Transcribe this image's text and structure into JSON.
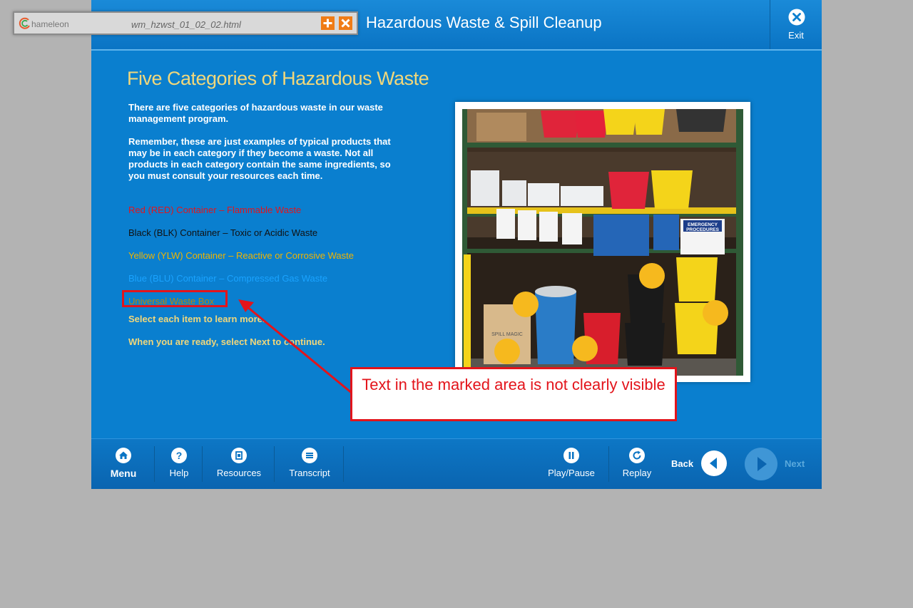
{
  "header": {
    "course_title": "Hazardous Waste & Spill Cleanup",
    "exit_label": "Exit"
  },
  "page": {
    "title": "Five Categories of Hazardous Waste",
    "intro_1": "There are five categories of hazardous waste in our waste management program.",
    "intro_2": "Remember, these are just examples of typical products that may be in each category if they become a waste.  Not all products in each category contain the same ingredients, so you must consult your resources each time.",
    "categories": [
      {
        "label": "Red (RED) Container – Flammable Waste",
        "color": "#e3141b"
      },
      {
        "label": "Black (BLK) Container – Toxic or Acidic Waste",
        "color": "#111111"
      },
      {
        "label": "Yellow (YLW) Container – Reactive or Corrosive Waste",
        "color": "#f0b400"
      },
      {
        "label": "Blue (BLU) Container – Compressed Gas Waste",
        "color": "#1aa3ff"
      },
      {
        "label": "Universal Waste Box",
        "color": "#b8860b"
      }
    ],
    "instruction_1": "Select each item to learn more.",
    "instruction_2": "When you are ready, select Next to continue.",
    "photo_signs": {
      "spill_box": "SPILL MAGIC",
      "emergency_line1": "EMERGENCY",
      "emergency_line2": "PROCEDURES"
    }
  },
  "footer": {
    "menu": "Menu",
    "help": "Help",
    "resources": "Resources",
    "transcript": "Transcript",
    "play_pause": "Play/Pause",
    "replay": "Replay",
    "back": "Back",
    "next": "Next"
  },
  "chameleon_bar": {
    "logo_text": "hameleon",
    "file_name": "wm_hzwst_01_02_02.html"
  },
  "annotation": {
    "callout_text": "Text in the marked area is not clearly visible"
  },
  "colors": {
    "accent_yellow": "#f1d77b",
    "course_blue": "#0a7fcf",
    "annotation_red": "#e3141b",
    "hotspot": "#f6b91e"
  }
}
